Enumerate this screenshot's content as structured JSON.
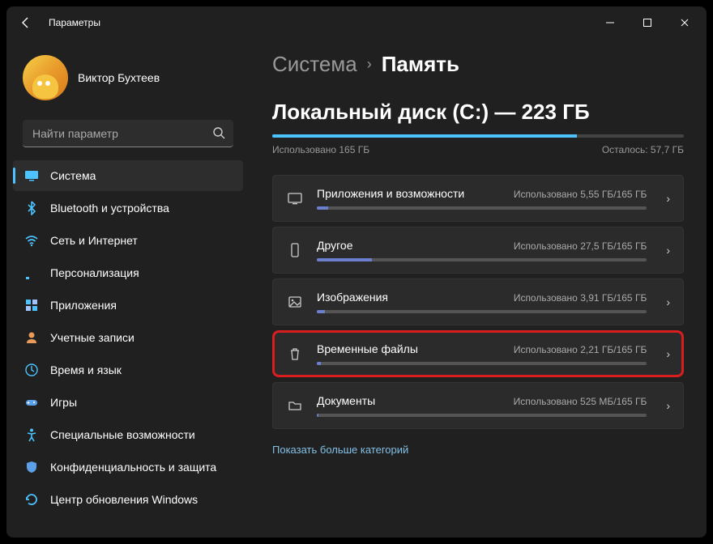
{
  "titlebar": {
    "app_name": "Параметры"
  },
  "profile": {
    "name": "Виктор Бухтеев",
    "email": " "
  },
  "search": {
    "placeholder": "Найти параметр"
  },
  "nav": {
    "items": [
      {
        "label": "Система"
      },
      {
        "label": "Bluetooth и устройства"
      },
      {
        "label": "Сеть и Интернет"
      },
      {
        "label": "Персонализация"
      },
      {
        "label": "Приложения"
      },
      {
        "label": "Учетные записи"
      },
      {
        "label": "Время и язык"
      },
      {
        "label": "Игры"
      },
      {
        "label": "Специальные возможности"
      },
      {
        "label": "Конфиденциальность и защита"
      },
      {
        "label": "Центр обновления Windows"
      }
    ]
  },
  "breadcrumb": {
    "parent": "Система",
    "current": "Память"
  },
  "disk": {
    "title": "Локальный диск (C:) — 223 ГБ",
    "used_label": "Использовано 165 ГБ",
    "free_label": "Осталось: 57,7 ГБ",
    "used_pct": 74
  },
  "categories": [
    {
      "label": "Приложения и возможности",
      "usage": "Использовано 5,55 ГБ/165 ГБ",
      "pct": 3.4
    },
    {
      "label": "Другое",
      "usage": "Использовано 27,5 ГБ/165 ГБ",
      "pct": 16.7
    },
    {
      "label": "Изображения",
      "usage": "Использовано 3,91 ГБ/165 ГБ",
      "pct": 2.4
    },
    {
      "label": "Временные файлы",
      "usage": "Использовано 2,21 ГБ/165 ГБ",
      "pct": 1.3
    },
    {
      "label": "Документы",
      "usage": "Использовано 525 МБ/165 ГБ",
      "pct": 0.3
    }
  ],
  "show_more": "Показать больше категорий"
}
